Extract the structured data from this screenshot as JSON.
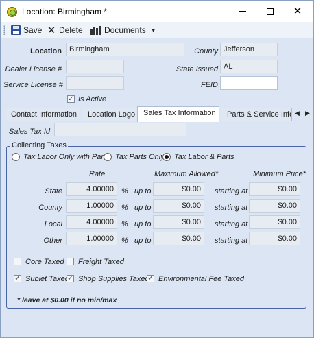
{
  "window": {
    "title": "Location: Birmingham *"
  },
  "toolbar": {
    "save_label": "Save",
    "delete_label": "Delete",
    "documents_label": "Documents"
  },
  "form": {
    "location_label": "Location",
    "location_value": "Birmingham",
    "county_label": "County",
    "county_value": "Jefferson",
    "dealer_license_label": "Dealer License #",
    "dealer_license_value": "",
    "state_issued_label": "State  Issued",
    "state_issued_value": "AL",
    "service_license_label": "Service License #",
    "service_license_value": "",
    "feid_label": "FEID",
    "feid_value": "",
    "is_active_label": "Is Active",
    "is_active_checked": true
  },
  "tabs": [
    {
      "label": "Contact Information",
      "active": false
    },
    {
      "label": "Location Logo",
      "active": false
    },
    {
      "label": "Sales Tax Information",
      "active": true
    },
    {
      "label": "Parts & Service Inform",
      "active": false
    }
  ],
  "sales_tax": {
    "sales_tax_id_label": "Sales Tax Id",
    "sales_tax_id_value": "",
    "group_title": "Collecting Taxes",
    "radio_options": [
      {
        "label": "Tax Labor Only with Parts",
        "selected": false
      },
      {
        "label": "Tax Parts Only",
        "selected": false
      },
      {
        "label": "Tax Labor & Parts",
        "selected": true
      }
    ],
    "headers": {
      "rate": "Rate",
      "max": "Maximum Allowed*",
      "min": "Minimum Price*"
    },
    "pct_symbol": "%",
    "up_to_label": "up to",
    "starting_at_label": "starting at",
    "rows": [
      {
        "label": "State",
        "rate": "4.00000",
        "max": "$0.00",
        "min": "$0.00"
      },
      {
        "label": "County",
        "rate": "1.00000",
        "max": "$0.00",
        "min": "$0.00"
      },
      {
        "label": "Local",
        "rate": "4.00000",
        "max": "$0.00",
        "min": "$0.00"
      },
      {
        "label": "Other",
        "rate": "1.00000",
        "max": "$0.00",
        "min": "$0.00"
      }
    ],
    "checkboxes": [
      {
        "label": "Core Taxed",
        "checked": false
      },
      {
        "label": "Freight Taxed",
        "checked": false
      },
      {
        "label": "Sublet Taxed",
        "checked": true
      },
      {
        "label": "Shop Supplies Taxed",
        "checked": true
      },
      {
        "label": "Environmental Fee Taxed",
        "checked": true
      }
    ],
    "note": "* leave at $0.00 if no min/max"
  }
}
